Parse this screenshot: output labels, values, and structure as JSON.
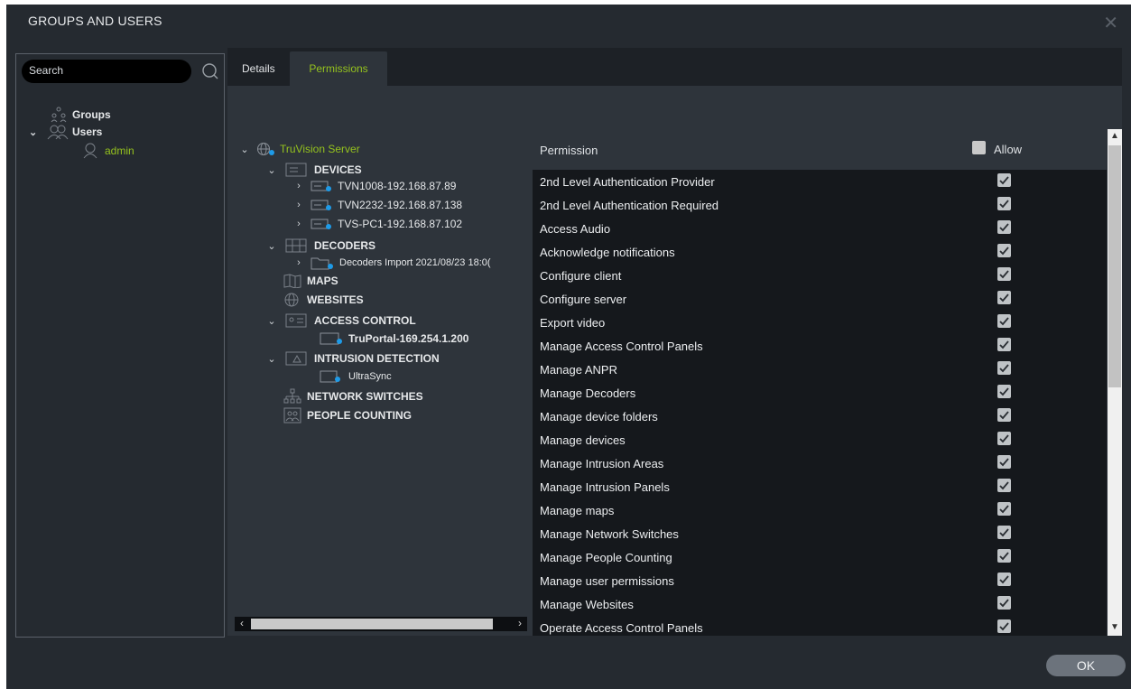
{
  "window": {
    "title": "GROUPS AND USERS",
    "close_glyph": "✕"
  },
  "left": {
    "search_placeholder": "Search",
    "groups_label": "Groups",
    "users_label": "Users",
    "admin_label": "admin"
  },
  "tabs": {
    "details": "Details",
    "permissions": "Permissions"
  },
  "tree": {
    "server": "TruVision Server",
    "devices": "DEVICES",
    "dev1": "TVN1008-192.168.87.89",
    "dev2": "TVN2232-192.168.87.138",
    "dev3": "TVS-PC1-192.168.87.102",
    "decoders": "DECODERS",
    "decoder_import": "Decoders Import 2021/08/23 18:0(",
    "maps": "MAPS",
    "websites": "WEBSITES",
    "access_control": "ACCESS CONTROL",
    "truportal": "TruPortal-169.254.1.200",
    "intrusion": "INTRUSION DETECTION",
    "ultrasync": "UltraSync",
    "network_switches": "NETWORK SWITCHES",
    "people_counting": "PEOPLE COUNTING"
  },
  "table": {
    "col_permission": "Permission",
    "col_allow": "Allow",
    "rows": [
      "2nd Level Authentication Provider",
      "2nd Level Authentication Required",
      "Access Audio",
      "Acknowledge notifications",
      "Configure client",
      "Configure server",
      "Export video",
      "Manage Access Control Panels",
      "Manage ANPR",
      "Manage Decoders",
      "Manage device folders",
      "Manage devices",
      "Manage Intrusion Areas",
      "Manage Intrusion Panels",
      "Manage maps",
      "Manage Network Switches",
      "Manage People Counting",
      "Manage user permissions",
      "Manage Websites",
      "Operate Access Control Panels"
    ]
  },
  "footer": {
    "ok_label": "OK"
  },
  "colors": {
    "accent_green": "#95c21e",
    "status_blue": "#1e9be8",
    "bg": "#252a30"
  }
}
